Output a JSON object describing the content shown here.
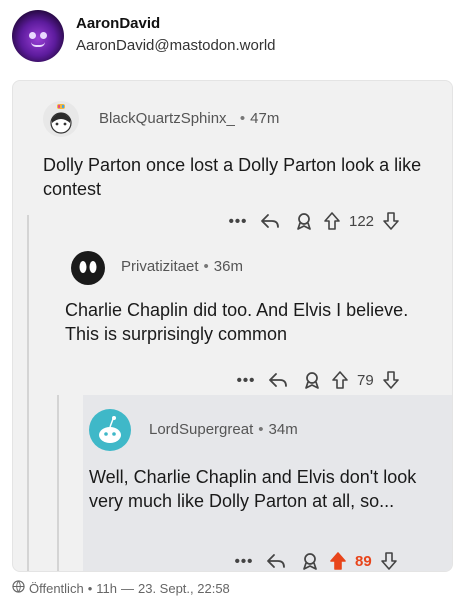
{
  "post": {
    "display_name": "AaronDavid",
    "handle": "AaronDavid@mastodon.world",
    "visibility": "Öffentlich",
    "time": "11h",
    "date": "23. Sept., 22:58",
    "separator": "•",
    "date_separator": "—"
  },
  "screenshot": {
    "comments": [
      {
        "username": "BlackQuartzSphinx_",
        "age": "47m",
        "text": "Dolly Parton once lost a Dolly Parton look a like contest",
        "score": "122",
        "upvoted": false
      },
      {
        "username": "Privatizitaet",
        "age": "36m",
        "text": "Charlie Chaplin did too. And Elvis I believe. This is surprisingly common",
        "score": "79",
        "upvoted": false
      },
      {
        "username": "LordSupergreat",
        "age": "34m",
        "text": "Well, Charlie Chaplin and Elvis don't look very much like Dolly Parton at all, so...",
        "score": "89",
        "upvoted": true
      }
    ],
    "more_label": "•••",
    "dot": "•"
  },
  "colors": {
    "upvote_active": "#e8451b",
    "background_nested": "#e6e7ea"
  }
}
